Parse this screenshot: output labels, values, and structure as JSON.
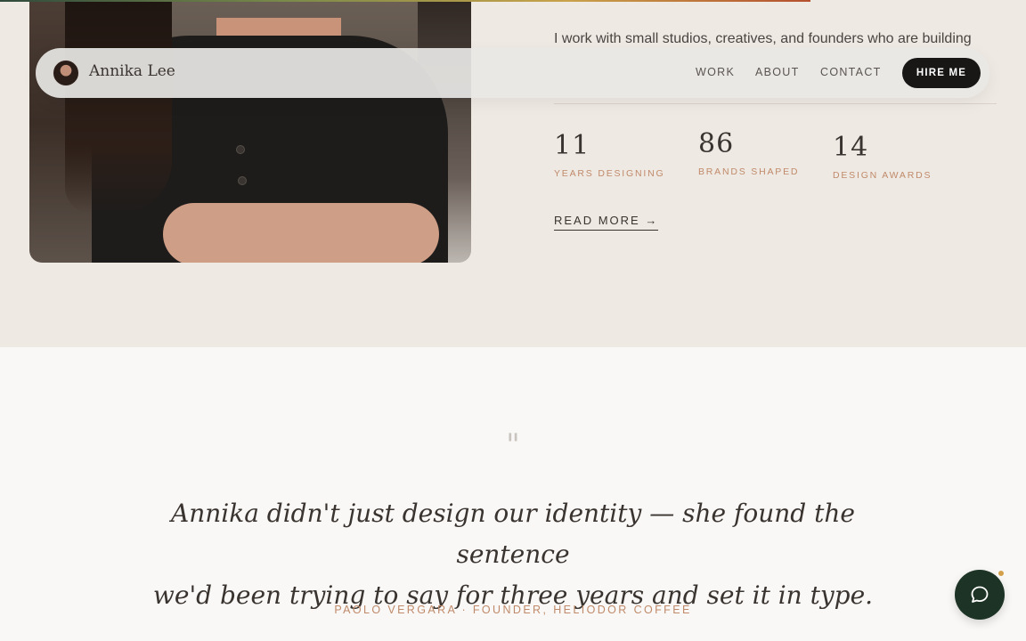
{
  "progress": {
    "value": 0.79,
    "color_start": "#2f4a3c",
    "color_end": "#b5502e"
  },
  "header": {
    "brand_name": "Annika Lee",
    "nav": [
      "WORK",
      "ABOUT",
      "CONTACT"
    ],
    "cta_label": "HIRE ME"
  },
  "about": {
    "intro": "I work with small studios, creatives, and founders who are building",
    "stats": [
      {
        "number": "11",
        "label": "YEARS DESIGNING"
      },
      {
        "number": "86",
        "label": "BRANDS SHAPED"
      },
      {
        "number": "14",
        "label": "DESIGN AWARDS"
      }
    ],
    "read_more": "READ MORE →"
  },
  "testimonial": {
    "quote_mark": "\"",
    "quote_line1": "Annika didn't just design our identity — she found the sentence",
    "quote_line2": "we'd been trying to say for three years and set it in type.",
    "author": "PAOLO VERGARA · FOUNDER, HELIODOR COFFEE"
  },
  "chat": {
    "icon": "chat-bubble-icon",
    "accent": "#1c3326",
    "badge_color": "#d2a04a"
  }
}
